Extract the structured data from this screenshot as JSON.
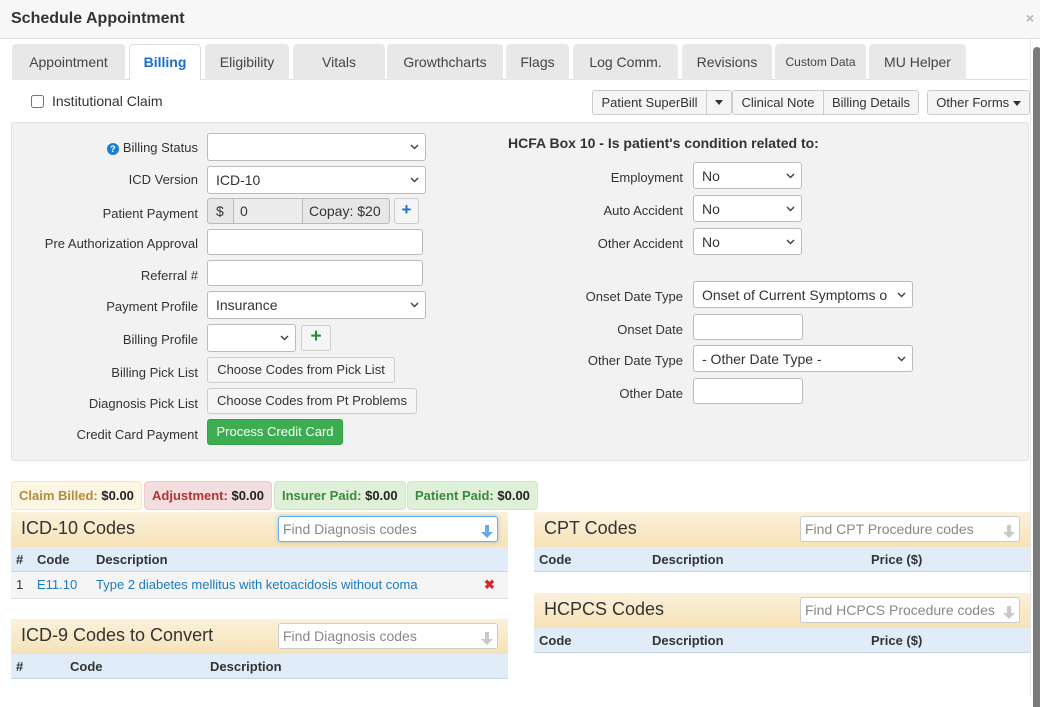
{
  "window": {
    "title": "Schedule Appointment",
    "close_icon": "×"
  },
  "tabs": [
    {
      "label": "Appointment",
      "active": false
    },
    {
      "label": "Billing",
      "active": true
    },
    {
      "label": "Eligibility",
      "active": false
    },
    {
      "label": "Vitals",
      "active": false
    },
    {
      "label": "Growthcharts",
      "active": false
    },
    {
      "label": "Flags",
      "active": false
    },
    {
      "label": "Log Comm.",
      "active": false
    },
    {
      "label": "Revisions",
      "active": false
    },
    {
      "label": "Custom Data",
      "active": false
    },
    {
      "label": "MU Helper",
      "active": false
    }
  ],
  "institutional_claim": {
    "label": "Institutional Claim",
    "checked": false
  },
  "toolbar": {
    "patient_superbill": "Patient SuperBill",
    "clinical_note": "Clinical Note",
    "billing_details": "Billing Details",
    "other_forms": "Other Forms"
  },
  "billing_form": {
    "billing_status": {
      "label": "Billing Status",
      "value": ""
    },
    "icd_version": {
      "label": "ICD Version",
      "value": "ICD-10"
    },
    "patient_payment": {
      "label": "Patient Payment",
      "currency": "$",
      "value": "0",
      "copay": "Copay: $20",
      "add": "+"
    },
    "pre_auth": {
      "label": "Pre Authorization Approval",
      "value": ""
    },
    "referral": {
      "label": "Referral #",
      "value": ""
    },
    "payment_profile": {
      "label": "Payment Profile",
      "value": "Insurance"
    },
    "billing_profile": {
      "label": "Billing Profile",
      "value": "",
      "add": "+"
    },
    "billing_pick_list": {
      "label": "Billing Pick List",
      "button": "Choose Codes from Pick List"
    },
    "diagnosis_pick_list": {
      "label": "Diagnosis Pick List",
      "button": "Choose Codes from Pt Problems"
    },
    "credit_card": {
      "label": "Credit Card Payment",
      "button": "Process Credit Card"
    }
  },
  "hcfa": {
    "heading": "HCFA Box 10 - Is patient's condition related to:",
    "employment": {
      "label": "Employment",
      "value": "No"
    },
    "auto_accident": {
      "label": "Auto Accident",
      "value": "No"
    },
    "other_accident": {
      "label": "Other Accident",
      "value": "No"
    },
    "onset_date_type": {
      "label": "Onset Date Type",
      "value": "Onset of Current Symptoms o"
    },
    "onset_date": {
      "label": "Onset Date",
      "value": ""
    },
    "other_date_type": {
      "label": "Other Date Type",
      "value": "- Other Date Type -"
    },
    "other_date": {
      "label": "Other Date",
      "value": ""
    }
  },
  "badges": [
    {
      "label": "Claim Billed:",
      "value": "$0.00",
      "bg": "#fcf6e3",
      "border": "#f5e7c0",
      "color": "#b58a3c"
    },
    {
      "label": "Adjustment:",
      "value": "$0.00",
      "bg": "#f2dede",
      "border": "#ebcccc",
      "color": "#b53333"
    },
    {
      "label": "Insurer Paid:",
      "value": "$0.00",
      "bg": "#dff0d8",
      "border": "#cfe6c4",
      "color": "#3c8a3c"
    },
    {
      "label": "Patient Paid:",
      "value": "$0.00",
      "bg": "#dff0d8",
      "border": "#cfe6c4",
      "color": "#3c8a3c"
    }
  ],
  "icd10": {
    "title": "ICD-10 Codes",
    "search_placeholder": "Find Diagnosis codes",
    "columns": [
      "#",
      "Code",
      "Description"
    ],
    "rows": [
      {
        "num": "1",
        "code": "E11.10",
        "description": "Type 2 diabetes mellitus with ketoacidosis without coma",
        "delete_icon": "✖"
      }
    ]
  },
  "icd9": {
    "title": "ICD-9 Codes to Convert",
    "search_placeholder": "Find Diagnosis codes",
    "columns": [
      "#",
      "Code",
      "Description"
    ]
  },
  "cpt": {
    "title": "CPT Codes",
    "search_placeholder": "Find CPT Procedure codes",
    "columns": [
      "Code",
      "Description",
      "Price ($)"
    ]
  },
  "hcpcs": {
    "title": "HCPCS Codes",
    "search_placeholder": "Find HCPCS Procedure codes",
    "columns": [
      "Code",
      "Description",
      "Price ($)"
    ]
  }
}
